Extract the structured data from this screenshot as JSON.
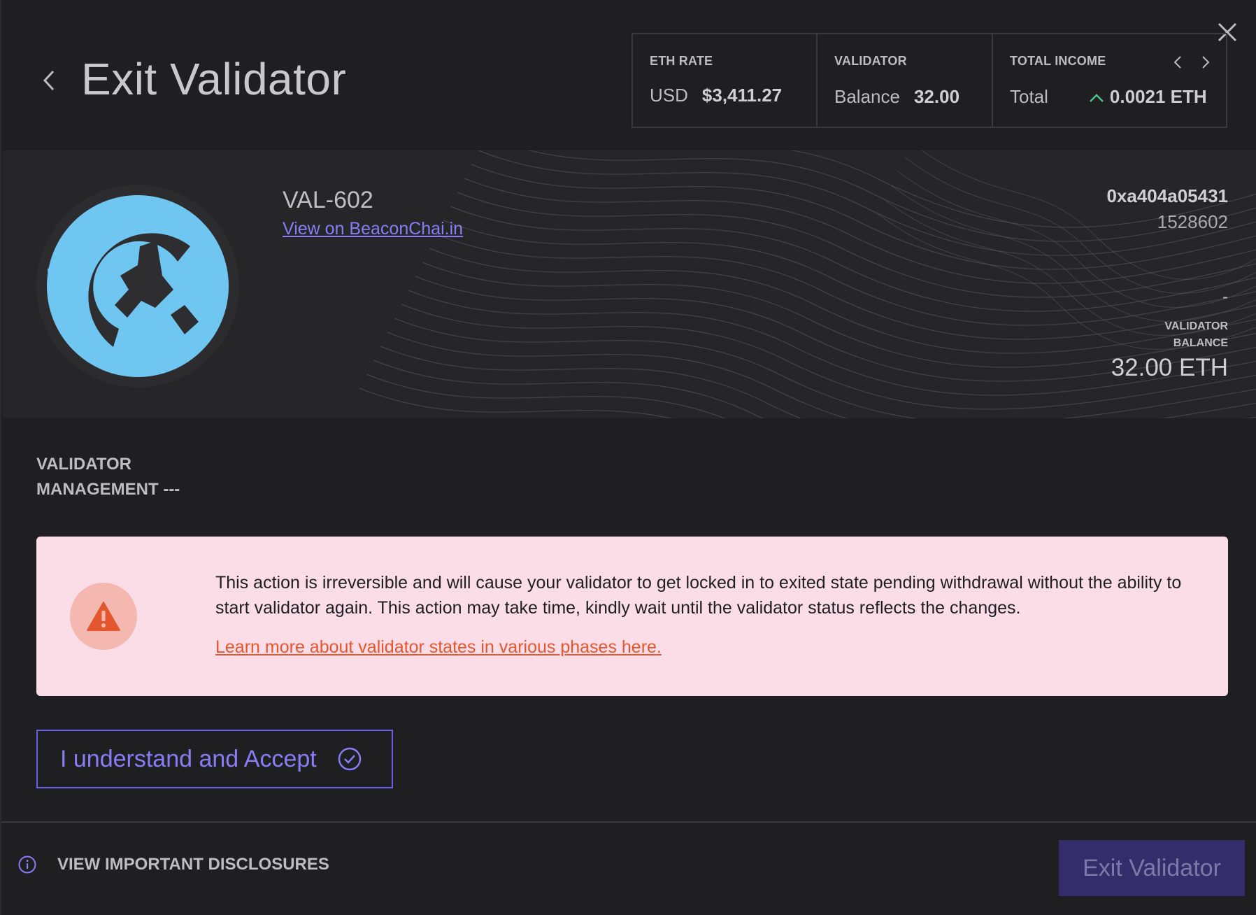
{
  "header": {
    "title": "Exit Validator"
  },
  "stats": {
    "eth_rate": {
      "label": "ETH RATE",
      "key": "USD",
      "value": "$3,411.27"
    },
    "validator": {
      "label": "VALIDATOR",
      "key": "Balance",
      "value": "32.00"
    },
    "total_income": {
      "label": "TOTAL INCOME",
      "key": "Total",
      "value": "0.0021 ETH"
    }
  },
  "validator_card": {
    "name": "VAL-602",
    "link_text": "View on BeaconChai.in",
    "address": "0xa404a05431",
    "index": "1528602",
    "status_placeholder": "-",
    "balance_label": "VALIDATOR BALANCE",
    "balance_value": "32.00 ETH"
  },
  "management": {
    "label": "VALIDATOR MANAGEMENT ---"
  },
  "warning": {
    "text": "This action is irreversible and will cause your validator to get locked in to exited state pending withdrawal without the ability to start validator again. This action may take time, kindly wait until the validator status reflects the changes.",
    "link_text": "Learn more about validator states in various phases here."
  },
  "accept": {
    "label": "I understand and Accept"
  },
  "footer": {
    "disclosures_label": "VIEW IMPORTANT DISCLOSURES",
    "exit_button_label": "Exit Validator"
  },
  "colors": {
    "background": "#1f1f21",
    "accent": "#8b7cf6",
    "avatar": "#6ec6f1",
    "warning_bg": "#fbdde7",
    "warning_icon": "#e4572e",
    "positive": "#4cc38a"
  },
  "icons": {
    "back": "chevron-left-icon",
    "close": "close-icon",
    "prev": "chevron-left-icon",
    "next": "chevron-right-icon",
    "trend": "chevron-up-icon",
    "warning": "warning-triangle-icon",
    "accept": "check-circle-icon",
    "info": "info-icon"
  }
}
